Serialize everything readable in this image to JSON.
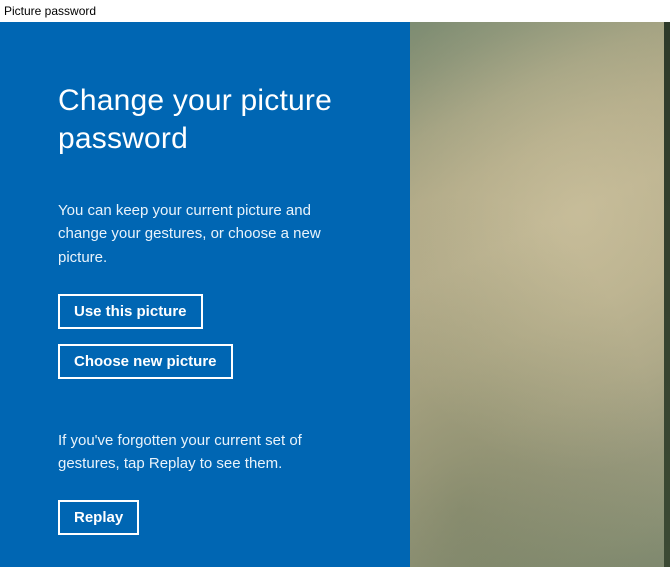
{
  "window": {
    "title": "Picture password"
  },
  "panel": {
    "heading": "Change your picture password",
    "intro": "You can keep your current picture and change your gestures, or choose a new picture.",
    "use_this_label": "Use this picture",
    "choose_new_label": "Choose new picture",
    "forgot_text": "If you've forgotten your current set of gestures, tap Replay to see them.",
    "replay_label": "Replay"
  }
}
